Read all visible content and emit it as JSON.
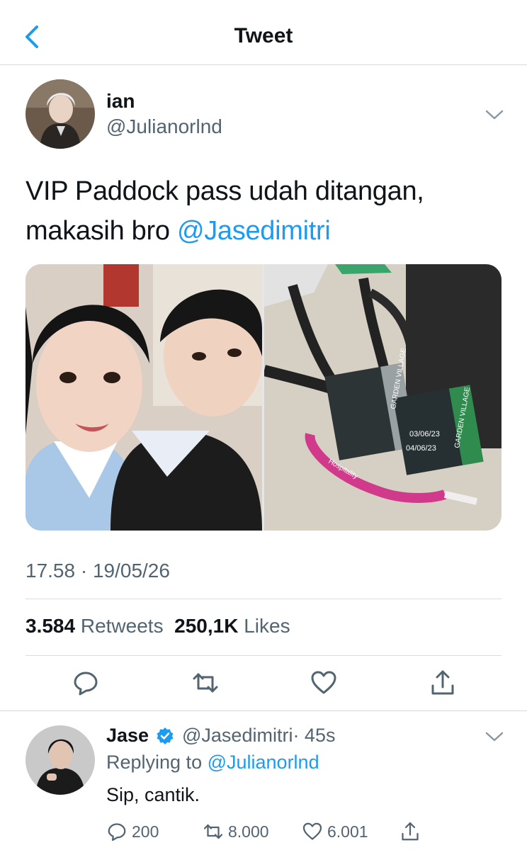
{
  "header": {
    "title": "Tweet"
  },
  "tweet": {
    "author": {
      "name": "ian",
      "handle": "@Julianorlnd"
    },
    "text_line1": "VIP Paddock pass udah ditangan,",
    "text_line2_prefix": "makasih bro ",
    "mention": "@Jasedimitri",
    "timestamp": "17.58 · 19/05/26",
    "retweets_count": "3.584",
    "retweets_label": "Retweets",
    "likes_count": "250,1K",
    "likes_label": "Likes",
    "media": {
      "pass_date_1": "03/06/23",
      "pass_date_2": "04/06/23",
      "pass_tag_1": "GARDEN VILLAGE",
      "pass_tag_2": "GARDEN VILLAGE",
      "wristband_text": "Hospitality"
    }
  },
  "reply": {
    "name": "Jase",
    "handle": "@Jasedimitri",
    "age": "· 45s",
    "replying_prefix": "Replying to ",
    "replying_to": "@Julianorlnd",
    "text": "Sip, cantik.",
    "reply_count": "200",
    "retweet_count": "8.000",
    "like_count": "6.001"
  },
  "colors": {
    "accent": "#1d9bf0",
    "secondary_text": "#536471",
    "primary_text": "#0f1419"
  },
  "icons": [
    "back-arrow-icon",
    "chevron-down-icon",
    "reply-icon",
    "retweet-icon",
    "like-icon",
    "share-icon",
    "verified-badge-icon"
  ]
}
